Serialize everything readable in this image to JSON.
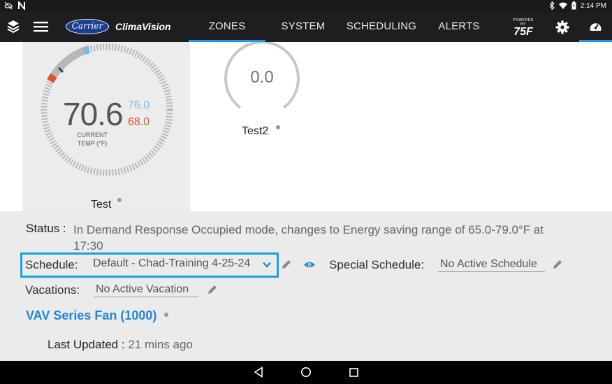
{
  "status_bar": {
    "time": "2:14 PM",
    "icons": [
      "cloud-off-icon",
      "notification-n-icon",
      "bluetooth-icon",
      "wifi-icon",
      "battery-icon"
    ]
  },
  "app_bar": {
    "logo_text": "Carrier",
    "brand": "ClimaVision",
    "tabs": [
      {
        "label": "ZONES",
        "active": true
      },
      {
        "label": "SYSTEM",
        "active": false
      },
      {
        "label": "SCHEDULING",
        "active": false
      },
      {
        "label": "ALERTS",
        "active": false
      }
    ],
    "powered_by": {
      "small": "POWERED BY",
      "big": "75F"
    },
    "icons": [
      "layers-icon",
      "menu-icon",
      "settings-icon",
      "dashboard-gauge-icon"
    ],
    "accent_color": "#2196f3"
  },
  "zones": [
    {
      "name": "Test",
      "selected": true,
      "current_temp": "70.6",
      "cooling_setpoint": "76.0",
      "heating_setpoint": "68.0",
      "temp_caption_line1": "CURRENT",
      "temp_caption_line2": "TEMP (°F)",
      "cooling_color": "#7fb9e6",
      "heating_color": "#e0532a"
    },
    {
      "name": "Test2",
      "selected": false,
      "current_temp": "0.0"
    }
  ],
  "details": {
    "status_label": "Status :",
    "status_text_line1": "In Demand Response Occupied mode, changes to Energy saving range of 65.0-79.0°F at",
    "status_text_line2": "17:30",
    "schedule_label": "Schedule:",
    "schedule_value": "Default - Chad-Training 4-25-24",
    "special_schedule_label": "Special Schedule:",
    "special_schedule_value": "No Active Schedule",
    "vacations_label": "Vacations:",
    "vacations_value": "No Active Vacation",
    "equipment_link": "VAV Series Fan (1000)",
    "last_updated_label": "Last Updated :",
    "last_updated_value": "21 mins ago"
  },
  "nav_bar": {
    "icons": [
      "back-icon",
      "home-icon",
      "recents-icon"
    ]
  }
}
